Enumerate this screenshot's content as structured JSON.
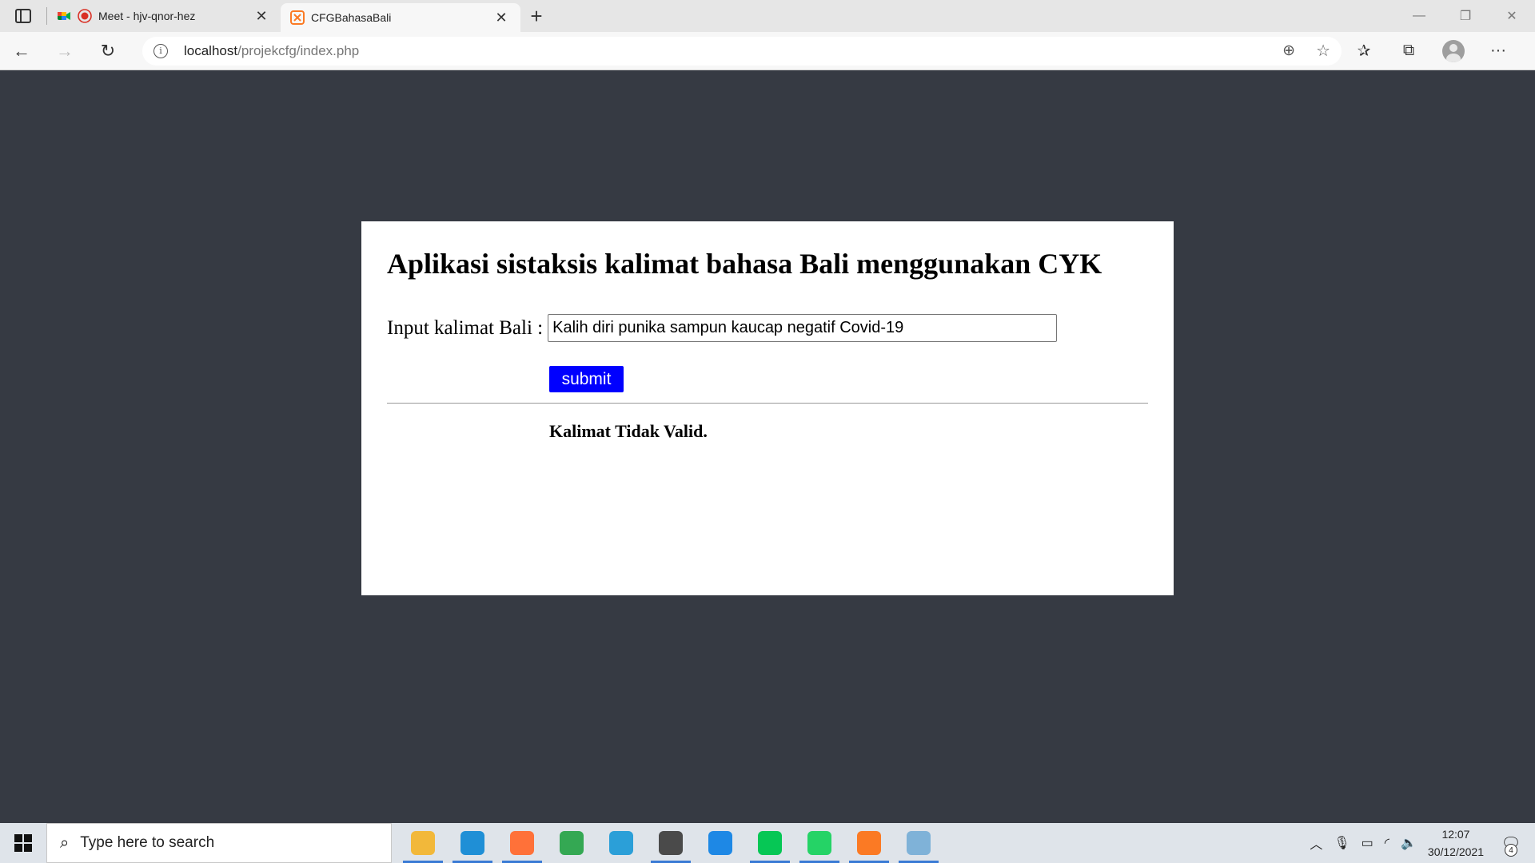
{
  "browser": {
    "tabs": [
      {
        "title": "Meet - hjv-qnor-hez",
        "favicon": "google-meet-icon",
        "recording": true,
        "active": false
      },
      {
        "title": "CFGBahasaBali",
        "favicon": "xampp-icon",
        "active": true
      }
    ],
    "new_tab_label": "+",
    "url_host": "localhost",
    "url_path": "/projekcfg/index.php"
  },
  "page": {
    "heading": "Aplikasi sistaksis kalimat bahasa Bali menggunakan CYK",
    "input_label": "Input kalimat Bali :",
    "input_value": "Kalih diri punika sampun kaucap negatif Covid-19",
    "submit_label": "submit",
    "result_text": "Kalimat Tidak Valid.",
    "colors": {
      "background": "#363a43",
      "card": "#ffffff",
      "submit_button": "#0000ff"
    }
  },
  "taskbar": {
    "search_placeholder": "Type here to search",
    "apps": [
      {
        "name": "file-explorer-icon",
        "color": "#f2b83a",
        "running": true
      },
      {
        "name": "edge-icon",
        "color": "#1f8fd6",
        "running": true
      },
      {
        "name": "firefox-icon",
        "color": "#ff7139",
        "running": true
      },
      {
        "name": "chrome-icon",
        "color": "#34a853",
        "running": false
      },
      {
        "name": "camera-app-icon",
        "color": "#2b9fd8",
        "running": false
      },
      {
        "name": "sublime-text-icon",
        "color": "#4a4a4a",
        "running": true
      },
      {
        "name": "vscode-icon",
        "color": "#1e88e5",
        "running": false
      },
      {
        "name": "line-icon",
        "color": "#06c755",
        "running": true
      },
      {
        "name": "whatsapp-icon",
        "color": "#25d366",
        "running": true
      },
      {
        "name": "xampp-icon",
        "color": "#fb7a24",
        "running": true
      },
      {
        "name": "notepad-icon",
        "color": "#7fb2d8",
        "running": true
      }
    ],
    "time": "12:07",
    "date": "30/12/2021",
    "notification_count": "4"
  }
}
